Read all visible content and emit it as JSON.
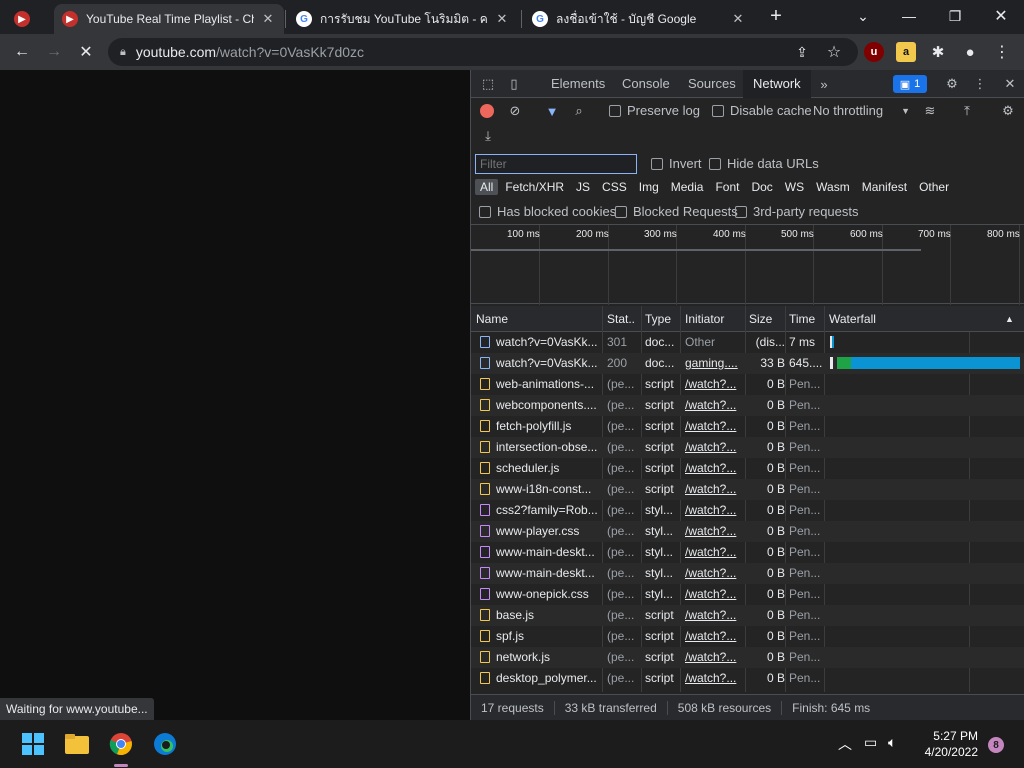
{
  "browser": {
    "tabs": [
      {
        "title": "YouTube Real Time Playlist - Chr",
        "active": true
      },
      {
        "title": "การรับชม YouTube โนริมมิต - คอมพ์",
        "active": false
      },
      {
        "title": "ลงชื่อเข้าใช้ - บัญชี Google",
        "active": false
      }
    ],
    "new_tab_icon": "plus-icon",
    "url_host": "youtube.com",
    "url_path": "/watch?v=0VasKk7d0zc",
    "status_bubble": "Waiting for www.youtube..."
  },
  "devtools": {
    "tabs": [
      "Elements",
      "Console",
      "Sources",
      "Network"
    ],
    "active_tab": "Network",
    "more_tabs": "»",
    "issues_count": "1",
    "toolbar": {
      "preserve_log": "Preserve log",
      "disable_cache": "Disable cache",
      "throttling": "No throttling"
    },
    "filter": {
      "placeholder": "Filter",
      "invert": "Invert",
      "hide_data_urls": "Hide data URLs"
    },
    "type_filters": [
      "All",
      "Fetch/XHR",
      "JS",
      "CSS",
      "Img",
      "Media",
      "Font",
      "Doc",
      "WS",
      "Wasm",
      "Manifest",
      "Other"
    ],
    "selected_type": "All",
    "options": {
      "blocked_cookies": "Has blocked cookies",
      "blocked_requests": "Blocked Requests",
      "third_party": "3rd-party requests"
    },
    "overview_ticks": [
      "100 ms",
      "200 ms",
      "300 ms",
      "400 ms",
      "500 ms",
      "600 ms",
      "700 ms",
      "800 ms"
    ],
    "columns": {
      "name": "Name",
      "status": "Stat..",
      "type": "Type",
      "initiator": "Initiator",
      "size": "Size",
      "time": "Time",
      "waterfall": "Waterfall"
    },
    "requests": [
      {
        "name": "watch?v=0VasKk...",
        "status": "301",
        "type": "doc...",
        "initiator": "Other",
        "size": "(dis...",
        "time": "7 ms",
        "kind": "doc"
      },
      {
        "name": "watch?v=0VasKk...",
        "status": "200",
        "type": "doc...",
        "initiator": "gaming....",
        "size": "33 B",
        "time": "645....",
        "kind": "doc"
      },
      {
        "name": "web-animations-...",
        "status": "(pe...",
        "type": "script",
        "initiator": "/watch?...",
        "size": "0 B",
        "time": "Pen...",
        "kind": "script"
      },
      {
        "name": "webcomponents....",
        "status": "(pe...",
        "type": "script",
        "initiator": "/watch?...",
        "size": "0 B",
        "time": "Pen...",
        "kind": "script"
      },
      {
        "name": "fetch-polyfill.js",
        "status": "(pe...",
        "type": "script",
        "initiator": "/watch?...",
        "size": "0 B",
        "time": "Pen...",
        "kind": "script"
      },
      {
        "name": "intersection-obse...",
        "status": "(pe...",
        "type": "script",
        "initiator": "/watch?...",
        "size": "0 B",
        "time": "Pen...",
        "kind": "script"
      },
      {
        "name": "scheduler.js",
        "status": "(pe...",
        "type": "script",
        "initiator": "/watch?...",
        "size": "0 B",
        "time": "Pen...",
        "kind": "script"
      },
      {
        "name": "www-i18n-const...",
        "status": "(pe...",
        "type": "script",
        "initiator": "/watch?...",
        "size": "0 B",
        "time": "Pen...",
        "kind": "script"
      },
      {
        "name": "css2?family=Rob...",
        "status": "(pe...",
        "type": "styl...",
        "initiator": "/watch?...",
        "size": "0 B",
        "time": "Pen...",
        "kind": "style"
      },
      {
        "name": "www-player.css",
        "status": "(pe...",
        "type": "styl...",
        "initiator": "/watch?...",
        "size": "0 B",
        "time": "Pen...",
        "kind": "style"
      },
      {
        "name": "www-main-deskt...",
        "status": "(pe...",
        "type": "styl...",
        "initiator": "/watch?...",
        "size": "0 B",
        "time": "Pen...",
        "kind": "style"
      },
      {
        "name": "www-main-deskt...",
        "status": "(pe...",
        "type": "styl...",
        "initiator": "/watch?...",
        "size": "0 B",
        "time": "Pen...",
        "kind": "style"
      },
      {
        "name": "www-onepick.css",
        "status": "(pe...",
        "type": "styl...",
        "initiator": "/watch?...",
        "size": "0 B",
        "time": "Pen...",
        "kind": "style"
      },
      {
        "name": "base.js",
        "status": "(pe...",
        "type": "script",
        "initiator": "/watch?...",
        "size": "0 B",
        "time": "Pen...",
        "kind": "script"
      },
      {
        "name": "spf.js",
        "status": "(pe...",
        "type": "script",
        "initiator": "/watch?...",
        "size": "0 B",
        "time": "Pen...",
        "kind": "script"
      },
      {
        "name": "network.js",
        "status": "(pe...",
        "type": "script",
        "initiator": "/watch?...",
        "size": "0 B",
        "time": "Pen...",
        "kind": "script"
      },
      {
        "name": "desktop_polymer...",
        "status": "(pe...",
        "type": "script",
        "initiator": "/watch?...",
        "size": "0 B",
        "time": "Pen...",
        "kind": "script"
      }
    ],
    "summary": {
      "requests": "17 requests",
      "transferred": "33 kB transferred",
      "resources": "508 kB resources",
      "finish": "Finish: 645 ms"
    }
  },
  "taskbar": {
    "time": "5:27 PM",
    "date": "4/20/2022",
    "notifications": "8"
  },
  "colors": {
    "doc": "#8ab4f8",
    "script": "#f2c94c",
    "style": "#c58af9",
    "waterfall_green": "#1ea446",
    "waterfall_blue": "#0a94d4"
  }
}
